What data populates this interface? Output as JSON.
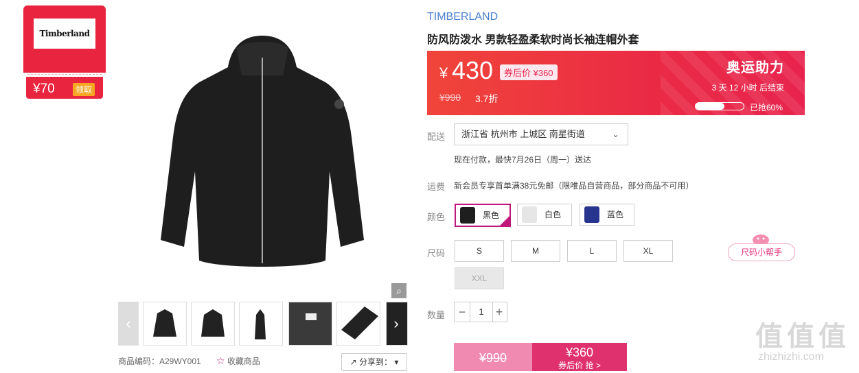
{
  "coupon": {
    "brand": "Timberland",
    "amount": "¥70",
    "action": "领取"
  },
  "product": {
    "brand": "TIMBERLAND",
    "title": "防风防泼水 男款轻盈柔软时尚长袖连帽外套",
    "code_label": "商品编码：A29WY001",
    "favorite_label": "收藏商品",
    "share_label": "分享到："
  },
  "price": {
    "currency": "¥",
    "current": "430",
    "coupon_price": "券后价 ¥360",
    "original": "¥990",
    "discount": "3.7折",
    "event": "奥运助力",
    "countdown": "3  天  12  小时  后结束",
    "sold_label": "已抢60%",
    "sold_fraction": 0.6
  },
  "delivery": {
    "label": "配送",
    "location": "浙江省 杭州市 上城区 南星街道",
    "note": "现在付款，最快7月26日（周一）送达"
  },
  "shipping": {
    "label": "运费",
    "text": "新会员专享首单满38元免邮（限唯品自营商品，部分商品不可用）"
  },
  "colors": {
    "label": "颜色",
    "options": [
      "黑色",
      "白色",
      "蓝色"
    ]
  },
  "sizes": {
    "label": "尺码",
    "options": [
      "S",
      "M",
      "L",
      "XL",
      "XXL"
    ],
    "helper": "尺码小帮手"
  },
  "quantity": {
    "label": "数量",
    "minus": "−",
    "value": "1",
    "plus": "+"
  },
  "buy": {
    "original": "¥990",
    "price": "¥360",
    "action": "券后价 抢 >"
  },
  "watermark": {
    "logo": "值值值",
    "site": "zhizhizhi.com"
  }
}
